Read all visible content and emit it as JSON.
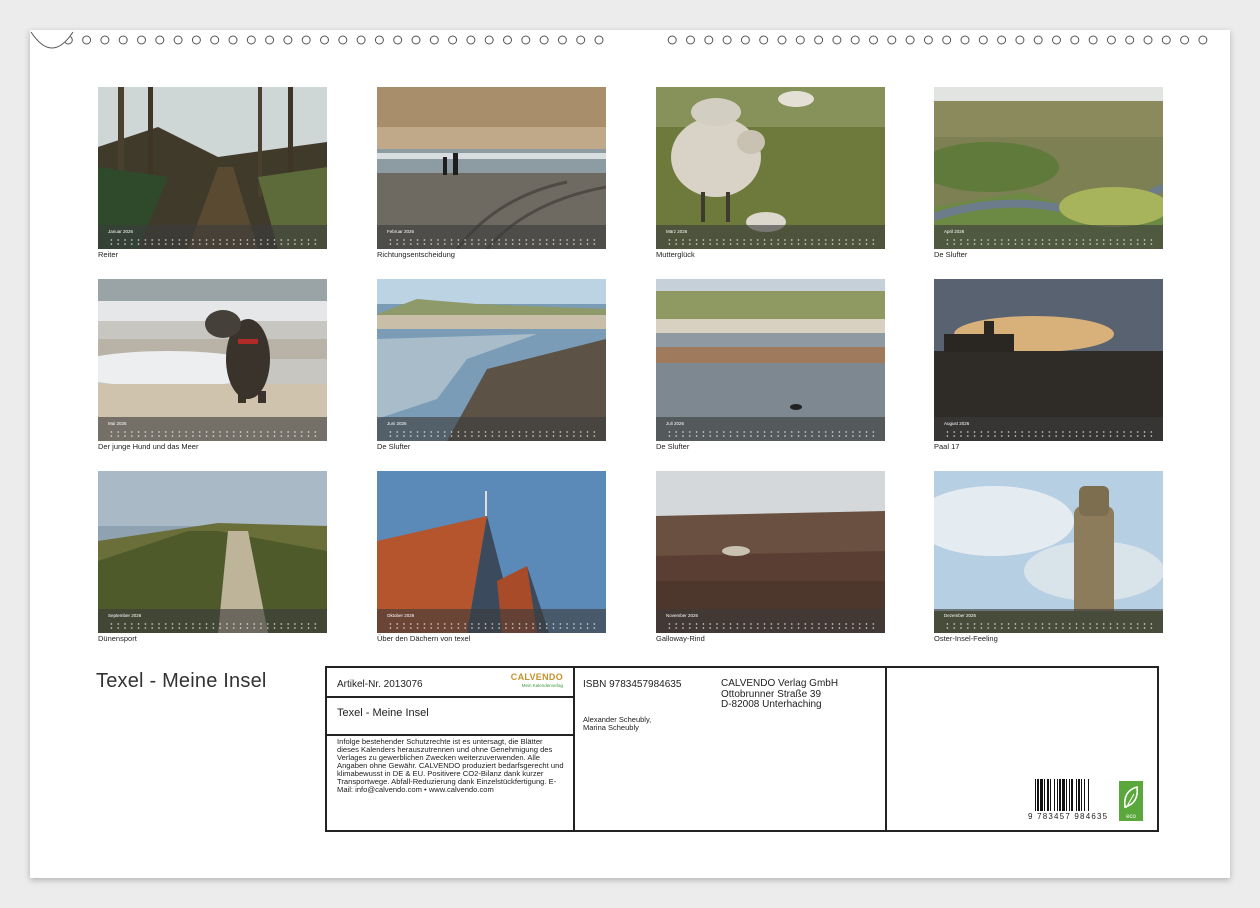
{
  "calendar_title": "Texel - Meine Insel",
  "thumbnails": [
    {
      "month": "Januar 2026",
      "caption": "Reiter"
    },
    {
      "month": "Februar 2026",
      "caption": "Richtungsentscheidung"
    },
    {
      "month": "März 2026",
      "caption": "Mutterglück"
    },
    {
      "month": "April 2026",
      "caption": "De Slufter"
    },
    {
      "month": "Mai 2026",
      "caption": "Der junge Hund und das Meer"
    },
    {
      "month": "Juni 2026",
      "caption": "De Slufter"
    },
    {
      "month": "Juli 2026",
      "caption": "De Slufter"
    },
    {
      "month": "August 2026",
      "caption": "Paal 17"
    },
    {
      "month": "September 2026",
      "caption": "Dünensport"
    },
    {
      "month": "Oktober 2026",
      "caption": "Über den Dächern von texel"
    },
    {
      "month": "November 2026",
      "caption": "Galloway-Rind"
    },
    {
      "month": "Dezember 2026",
      "caption": "Oster-Insel-Feeling"
    }
  ],
  "info": {
    "article_nr": "Artikel-Nr. 2013076",
    "logo_brand": "CALVENDO",
    "logo_sub": "Mein Kalenderverlag",
    "title": "Texel - Meine Insel",
    "legal": "Infolge bestehender Schutzrechte ist es untersagt, die Blätter dieses Kalenders herauszutrennen und ohne Genehmigung des Verlages zu gewerblichen Zwecken weiterzuverwenden. Alle Angaben ohne Gewähr. CALVENDO produziert bedarfsgerecht und klimabewusst in DE & EU. Positivere CO2-Bilanz dank kurzer Transportwege. Abfall-Reduzierung dank Einzelstückfertigung. E-Mail: info@calvendo.com • www.calvendo.com",
    "isbn": "ISBN 9783457984635",
    "authors_line1": "Alexander Scheubly,",
    "authors_line2": "Marina Scheubly",
    "publisher_line1": "CALVENDO Verlag GmbH",
    "publisher_line2": "Ottobrunner Straße 39",
    "publisher_line3": "D-82008 Unterhaching",
    "barcode_number": "9 783457 984635",
    "eco_label": "eco"
  },
  "colors": {
    "brand": "#c8912b",
    "eco_green": "#5aa83c"
  }
}
